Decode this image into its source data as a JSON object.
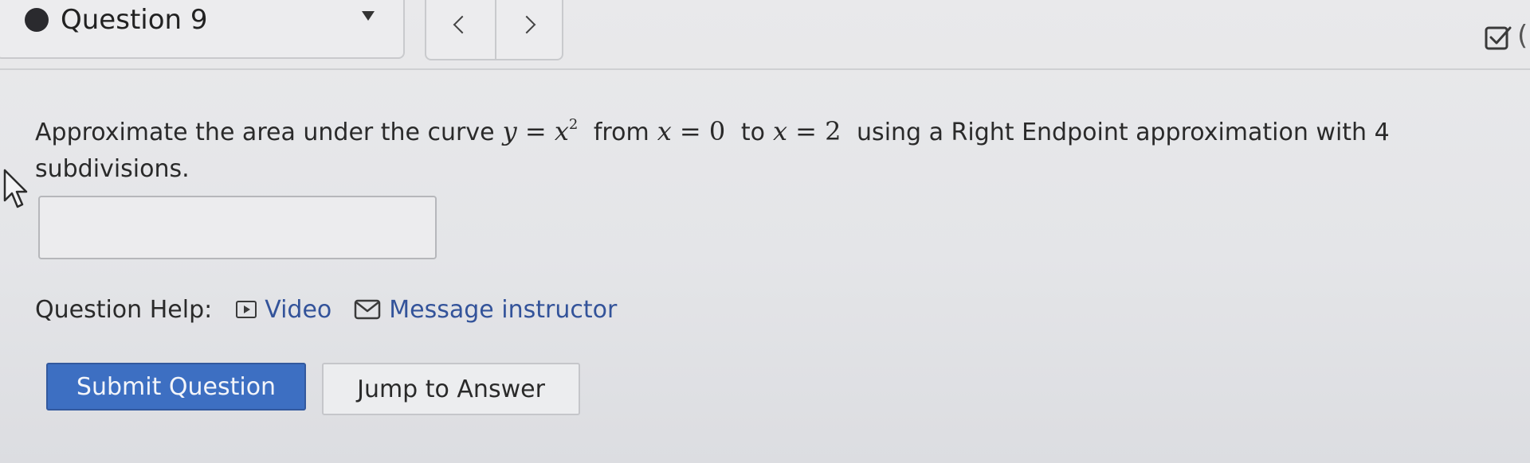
{
  "header": {
    "question_title": "Question 9",
    "prev_icon": "chevron-left-icon",
    "next_icon": "chevron-right-icon",
    "right_icon": "check-square-icon",
    "right_fragment": "("
  },
  "question": {
    "text_before": "Approximate the area under the curve",
    "eq_curve": {
      "lhs": "y",
      "rhs": "x",
      "exp": "2"
    },
    "word_from": "from",
    "eq_from": {
      "var": "x",
      "val": "0"
    },
    "word_to": "to",
    "eq_to": {
      "var": "x",
      "val": "2"
    },
    "text_after": "using a Right Endpoint approximation with 4 subdivisions."
  },
  "answer": {
    "value": "",
    "placeholder": ""
  },
  "help": {
    "label": "Question Help:",
    "video_label": "Video",
    "message_label": "Message instructor"
  },
  "buttons": {
    "submit": "Submit Question",
    "jump": "Jump to Answer"
  },
  "colors": {
    "accent": "#3d6fc2",
    "link": "#33539a"
  }
}
